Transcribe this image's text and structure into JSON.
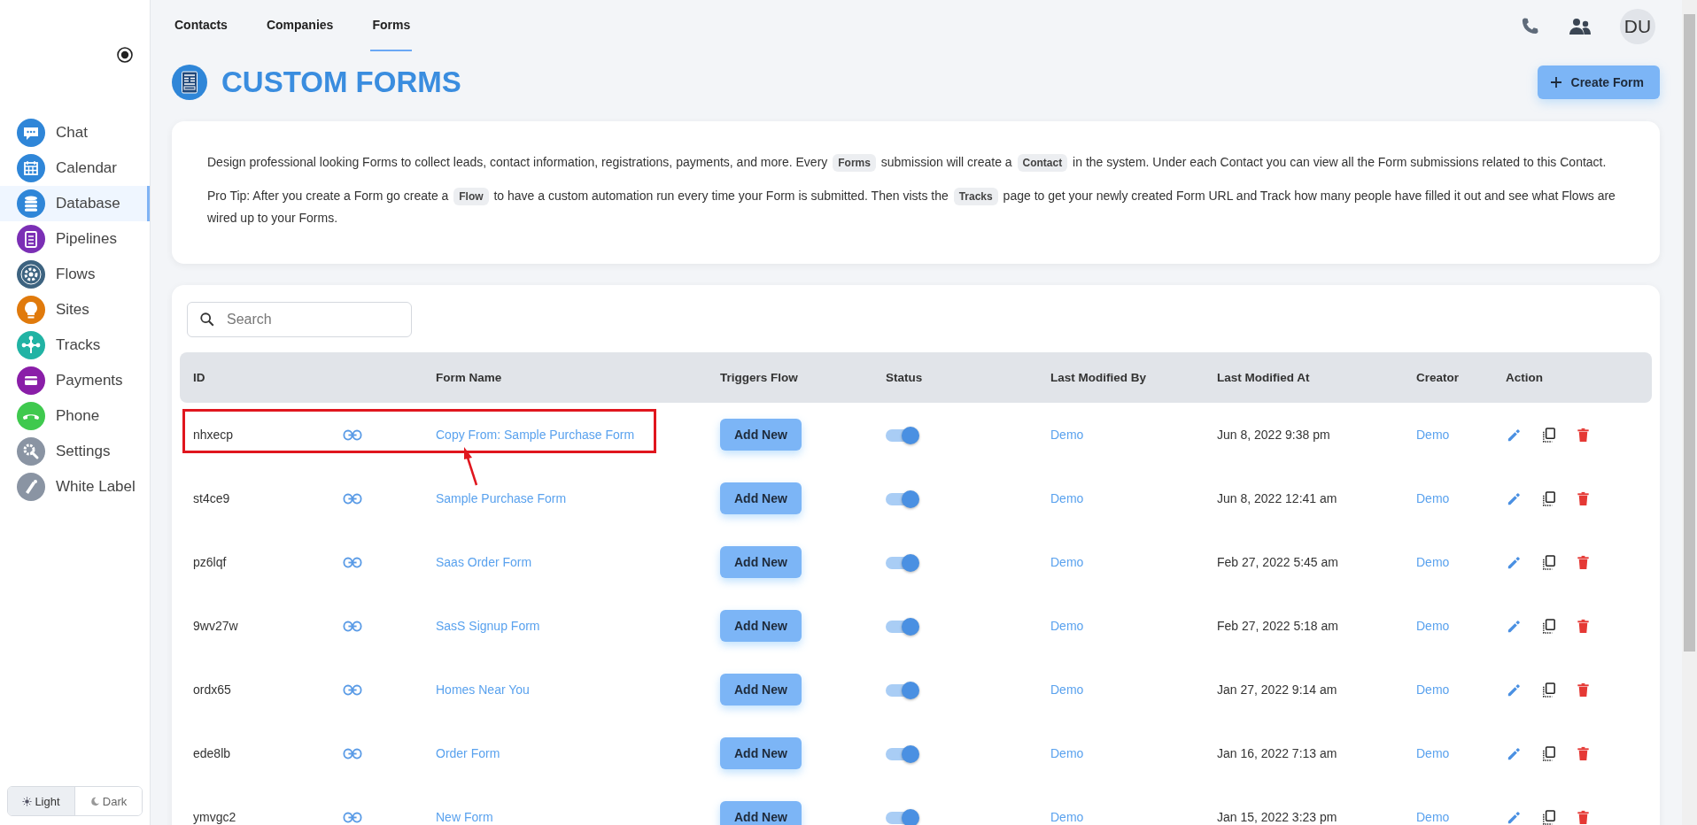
{
  "sidebar": {
    "items": [
      {
        "label": "Chat",
        "color": "#2f86d8",
        "selected": false
      },
      {
        "label": "Calendar",
        "color": "#2f86d8",
        "selected": false
      },
      {
        "label": "Database",
        "color": "#2f86d8",
        "selected": true
      },
      {
        "label": "Pipelines",
        "color": "#7b2fb5",
        "selected": false
      },
      {
        "label": "Flows",
        "color": "#3d6380",
        "selected": false
      },
      {
        "label": "Sites",
        "color": "#e07a0c",
        "selected": false
      },
      {
        "label": "Tracks",
        "color": "#21b3a4",
        "selected": false
      },
      {
        "label": "Payments",
        "color": "#8a1ea8",
        "selected": false
      },
      {
        "label": "Phone",
        "color": "#3fc94e",
        "selected": false
      },
      {
        "label": "Settings",
        "color": "#8a94a3",
        "selected": false
      },
      {
        "label": "White Label",
        "color": "#8a94a3",
        "selected": false
      }
    ],
    "theme_toggle": [
      {
        "label": "Light",
        "selected": true
      },
      {
        "label": "Dark",
        "selected": false
      }
    ]
  },
  "tabs": [
    {
      "label": "Contacts",
      "selected": false
    },
    {
      "label": "Companies",
      "selected": false
    },
    {
      "label": "Forms",
      "selected": true
    }
  ],
  "avatar": "DU",
  "page_title": "CUSTOM FORMS",
  "create_button": "Create Form",
  "description": [
    [
      {
        "text": "Design professional looking Forms to collect leads, contact information, registrations, payments, and more. Every "
      },
      {
        "chip": "Forms"
      },
      {
        "text": " submission will create a "
      },
      {
        "chip": "Contact"
      },
      {
        "text": " in the system. Under each Contact you can view all the Form submissions related to this Contact."
      }
    ],
    [
      {
        "text": "Pro Tip: After you create a Form go create a "
      },
      {
        "chip": "Flow"
      },
      {
        "text": " to have a custom automation run every time your Form is submitted. Then vists the "
      },
      {
        "chip": "Tracks"
      },
      {
        "text": " page to get your newly created Form URL and Track how many people have filled it out and see what Flows are wired up to your Forms."
      }
    ]
  ],
  "search": {
    "placeholder": "Search"
  },
  "table": {
    "columns": [
      "ID",
      "Form Name",
      "Triggers Flow",
      "Status",
      "Last Modified By",
      "Last Modified At",
      "Creator",
      "Action"
    ],
    "rows": [
      {
        "id": "nhxecp",
        "name": "Copy From: Sample Purchase Form",
        "trigger": "Add New",
        "on": true,
        "modified_by": "Demo",
        "modified_at": "Jun 8, 2022 9:38 pm",
        "creator": "Demo",
        "highlighted": true
      },
      {
        "id": "st4ce9",
        "name": "Sample Purchase Form",
        "trigger": "Add New",
        "on": true,
        "modified_by": "Demo",
        "modified_at": "Jun 8, 2022 12:41 am",
        "creator": "Demo",
        "highlighted": false
      },
      {
        "id": "pz6lqf",
        "name": "Saas Order Form",
        "trigger": "Add New",
        "on": true,
        "modified_by": "Demo",
        "modified_at": "Feb 27, 2022 5:45 am",
        "creator": "Demo",
        "highlighted": false
      },
      {
        "id": "9wv27w",
        "name": "SasS Signup Form",
        "trigger": "Add New",
        "on": true,
        "modified_by": "Demo",
        "modified_at": "Feb 27, 2022 5:18 am",
        "creator": "Demo",
        "highlighted": false
      },
      {
        "id": "ordx65",
        "name": "Homes Near You",
        "trigger": "Add New",
        "on": true,
        "modified_by": "Demo",
        "modified_at": "Jan 27, 2022 9:14 am",
        "creator": "Demo",
        "highlighted": false
      },
      {
        "id": "ede8lb",
        "name": "Order Form",
        "trigger": "Add New",
        "on": true,
        "modified_by": "Demo",
        "modified_at": "Jan 16, 2022 7:13 am",
        "creator": "Demo",
        "highlighted": false
      },
      {
        "id": "ymvgc2",
        "name": "New Form",
        "trigger": "Add New",
        "on": true,
        "modified_by": "Demo",
        "modified_at": "Jan 15, 2022 3:23 pm",
        "creator": "Demo",
        "highlighted": false
      }
    ]
  }
}
